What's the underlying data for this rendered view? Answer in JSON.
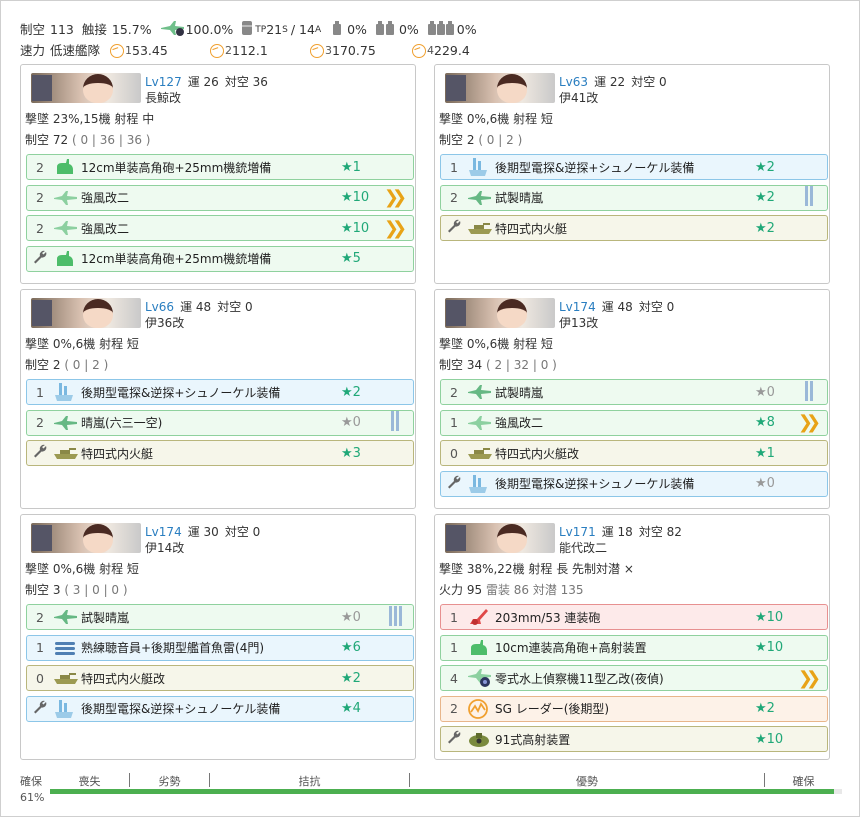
{
  "header": {
    "seiku_label": "制空",
    "seiku_value": "113",
    "shokusetsu_label": "触接",
    "shokusetsu_value": "15.7%",
    "plane_pct": "100.0%",
    "tp_value": "21",
    "tp_sub": "S",
    "tp_sep": "/ 14",
    "tp_sub2": "A",
    "tp_prefix": "TP",
    "drum1": "0%",
    "drum2": "0%",
    "drum3": "0%",
    "speed_label": "速力",
    "speed_value": "低速艦隊",
    "ap": [
      {
        "n": "1",
        "v": "53.45"
      },
      {
        "n": "2",
        "v": "112.1"
      },
      {
        "n": "3",
        "v": "170.75"
      },
      {
        "n": "4",
        "v": "229.4"
      }
    ]
  },
  "ships": [
    {
      "lv_label": "Lv",
      "lv": "127",
      "luck_label": "運",
      "luck": "26",
      "aa_label": "対空",
      "aa": "36",
      "name": "長鯨改",
      "line1": "撃墜 23%,15機  射程 中",
      "line2_label": "制空",
      "line2_value": "72",
      "line2_detail": "( 0 | 36 | 36 )",
      "slots": [
        {
          "count": "2",
          "name": "12cm単装高角砲+25mm機銃増備",
          "star": "1",
          "icon": "gun-icon"
        },
        {
          "count": "2",
          "name": "強風改二",
          "star": "10",
          "icon": "seaplane-fighter-icon"
        },
        {
          "count": "2",
          "name": "強風改二",
          "star": "10",
          "icon": "seaplane-fighter-icon"
        },
        {
          "count": "",
          "name": "12cm単装高角砲+25mm機銃増備",
          "star": "5",
          "icon": "gun-icon"
        }
      ]
    },
    {
      "lv_label": "Lv",
      "lv": "63",
      "luck_label": "運",
      "luck": "22",
      "aa_label": "対空",
      "aa": "0",
      "name": "伊41改",
      "line1": "撃墜 0%,6機  射程 短",
      "line2_label": "制空",
      "line2_value": "2",
      "line2_detail": "( 0 | 2 )",
      "slots": [
        {
          "count": "1",
          "name": "後期型電探&逆探+シュノーケル装備",
          "star": "2",
          "icon": "radar-snorkel-icon"
        },
        {
          "count": "2",
          "name": "試製晴嵐",
          "star": "2",
          "icon": "seaplane-bomber-icon"
        },
        {
          "count": "",
          "name": "特四式内火艇",
          "star": "2",
          "icon": "landing-craft-icon"
        }
      ]
    },
    {
      "lv_label": "Lv",
      "lv": "66",
      "luck_label": "運",
      "luck": "48",
      "aa_label": "対空",
      "aa": "0",
      "name": "伊36改",
      "line1": "撃墜 0%,6機  射程 短",
      "line2_label": "制空",
      "line2_value": "2",
      "line2_detail": "( 0 | 2 )",
      "slots": [
        {
          "count": "1",
          "name": "後期型電探&逆探+シュノーケル装備",
          "star": "2",
          "icon": "radar-snorkel-icon"
        },
        {
          "count": "2",
          "name": "晴嵐(六三一空)",
          "star": "0",
          "icon": "seaplane-bomber-icon"
        },
        {
          "count": "",
          "name": "特四式内火艇",
          "star": "3",
          "icon": "landing-craft-icon"
        }
      ]
    },
    {
      "lv_label": "Lv",
      "lv": "174",
      "luck_label": "運",
      "luck": "48",
      "aa_label": "対空",
      "aa": "0",
      "name": "伊13改",
      "line1": "撃墜 0%,6機  射程 短",
      "line2_label": "制空",
      "line2_value": "34",
      "line2_detail": "( 2 | 32 | 0 )",
      "slots": [
        {
          "count": "2",
          "name": "試製晴嵐",
          "star": "0",
          "icon": "seaplane-bomber-icon"
        },
        {
          "count": "1",
          "name": "強風改二",
          "star": "8",
          "icon": "seaplane-fighter-icon"
        },
        {
          "count": "0",
          "name": "特四式内火艇改",
          "star": "1",
          "icon": "landing-craft-icon"
        },
        {
          "count": "",
          "name": "後期型電探&逆探+シュノーケル装備",
          "star": "0",
          "icon": "radar-snorkel-icon"
        }
      ]
    },
    {
      "lv_label": "Lv",
      "lv": "174",
      "luck_label": "運",
      "luck": "30",
      "aa_label": "対空",
      "aa": "0",
      "name": "伊14改",
      "line1": "撃墜 0%,6機  射程 短",
      "line2_label": "制空",
      "line2_value": "3",
      "line2_detail": "( 3 | 0 | 0 )",
      "slots": [
        {
          "count": "2",
          "name": "試製晴嵐",
          "star": "0",
          "icon": "seaplane-bomber-icon"
        },
        {
          "count": "1",
          "name": "熟練聴音員+後期型艦首魚雷(4門)",
          "star": "6",
          "icon": "torpedo-icon"
        },
        {
          "count": "0",
          "name": "特四式内火艇改",
          "star": "2",
          "icon": "landing-craft-icon"
        },
        {
          "count": "",
          "name": "後期型電探&逆探+シュノーケル装備",
          "star": "4",
          "icon": "radar-snorkel-icon"
        }
      ]
    },
    {
      "lv_label": "Lv",
      "lv": "171",
      "luck_label": "運",
      "luck": "18",
      "aa_label": "対空",
      "aa": "82",
      "name": "能代改二",
      "line1": "撃墜 38%,22機  射程 長  先制対潜 ×",
      "line2_label": "火力",
      "line2_value": "95",
      "line2_detail": "雷装 86  対潜 135",
      "slots": [
        {
          "count": "1",
          "name": "203mm/53 連装砲",
          "star": "10",
          "icon": "main-gun-icon"
        },
        {
          "count": "1",
          "name": "10cm連装高角砲+高射装置",
          "star": "10",
          "icon": "gun-icon"
        },
        {
          "count": "4",
          "name": "零式水上偵察機11型乙改(夜偵)",
          "star": "",
          "icon": "recon-seaplane-icon"
        },
        {
          "count": "2",
          "name": "SG レーダー(後期型)",
          "star": "2",
          "icon": "radar-icon"
        },
        {
          "count": "",
          "name": "91式高射装置",
          "star": "10",
          "icon": "aa-director-icon"
        }
      ]
    }
  ],
  "gauge": {
    "label_left": "確保",
    "percent": "61%",
    "segments": [
      "喪失",
      "劣勢",
      "拮抗",
      "優勢",
      "確保"
    ],
    "fill": 0.99
  }
}
